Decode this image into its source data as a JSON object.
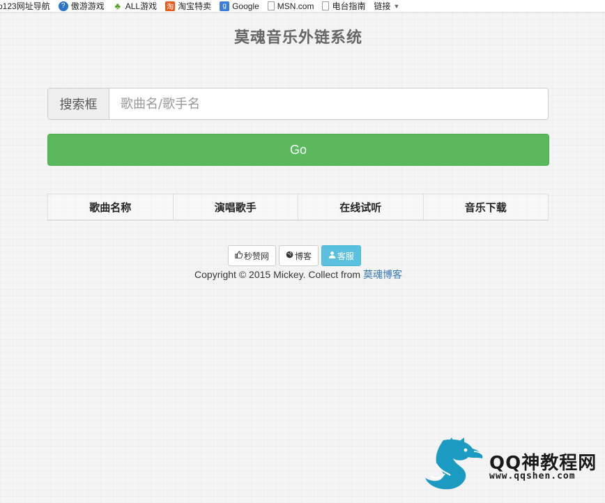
{
  "bookmarks": [
    {
      "label": "o123网址导航",
      "icon": "none"
    },
    {
      "label": "傲游游戏",
      "icon": "maxthon-icon"
    },
    {
      "label": "ALL游戏",
      "icon": "leaf-icon"
    },
    {
      "label": "淘宝特卖",
      "icon": "taobao-icon"
    },
    {
      "label": "Google",
      "icon": "google-icon"
    },
    {
      "label": "MSN.com",
      "icon": "page-icon"
    },
    {
      "label": "电台指南",
      "icon": "page-icon"
    },
    {
      "label": "链接",
      "icon": "chevron-down-icon"
    }
  ],
  "page": {
    "title": "莫魂音乐外链系统"
  },
  "search": {
    "addon_label": "搜索框",
    "placeholder": "歌曲名/歌手名",
    "value": ""
  },
  "go_button": {
    "label": "Go"
  },
  "table": {
    "headers": [
      "歌曲名称",
      "演唱歌手",
      "在线试听",
      "音乐下载"
    ]
  },
  "footer": {
    "buttons": [
      {
        "label": "秒赞网",
        "icon": "thumbs-up-icon"
      },
      {
        "label": "博客",
        "icon": "globe-icon"
      },
      {
        "label": "客服",
        "icon": "user-icon"
      }
    ],
    "copyright_prefix": "Copyright © 2015 Mickey. Collect from ",
    "copyright_link": "莫魂博客"
  },
  "watermark": {
    "name": "QQ神教程网",
    "url": "www.qqshen.com"
  },
  "colors": {
    "go_green": "#5cb85c",
    "info_blue": "#5bc0de",
    "link_blue": "#337ab7",
    "logo_teal": "#1b9bc2"
  }
}
